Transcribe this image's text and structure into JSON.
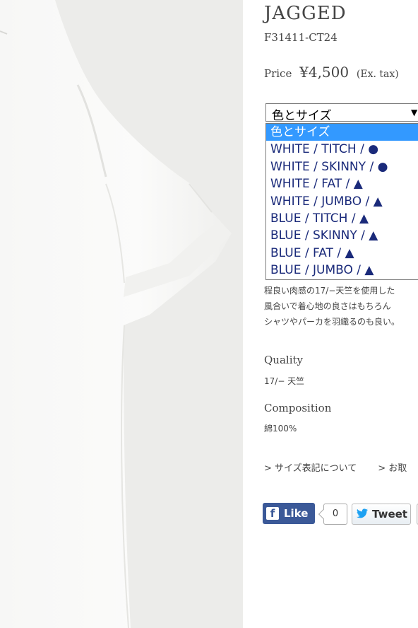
{
  "product": {
    "title": "JAGGED",
    "code": "F31411-CT24",
    "price_prefix": "Price",
    "price_amount": "¥4,500",
    "price_tax": "(Ex. tax)"
  },
  "select": {
    "value": "色とサイズ",
    "arrow": "▼",
    "options": [
      "色とサイズ",
      "WHITE / TITCH / ●",
      "WHITE / SKINNY / ●",
      "WHITE / FAT / ▲",
      "WHITE / JUMBO / ▲",
      "BLUE / TITCH / ▲",
      "BLUE / SKINNY / ▲",
      "BLUE / FAT / ▲",
      "BLUE / JUMBO / ▲"
    ]
  },
  "description": {
    "line1": "程良い肉感の17/−天竺を使用した",
    "line2": "風合いで着心地の良さはもちろん",
    "line3": "シャツやパーカを羽織るのも良い。"
  },
  "specs": {
    "quality_label": "Quality",
    "quality_value": "17/− 天竺",
    "composition_label": "Composition",
    "composition_value": "綿100%"
  },
  "links": {
    "size_guide": "> サイズ表記について",
    "other": "> お取"
  },
  "social": {
    "fb_icon": "f",
    "like_label": "Like",
    "like_count": "0",
    "tweet_label": "Tweet"
  },
  "colors": {
    "selected_option_bg": "#3399ff",
    "facebook": "#3b5998",
    "twitter_bird": "#1da1f2"
  }
}
